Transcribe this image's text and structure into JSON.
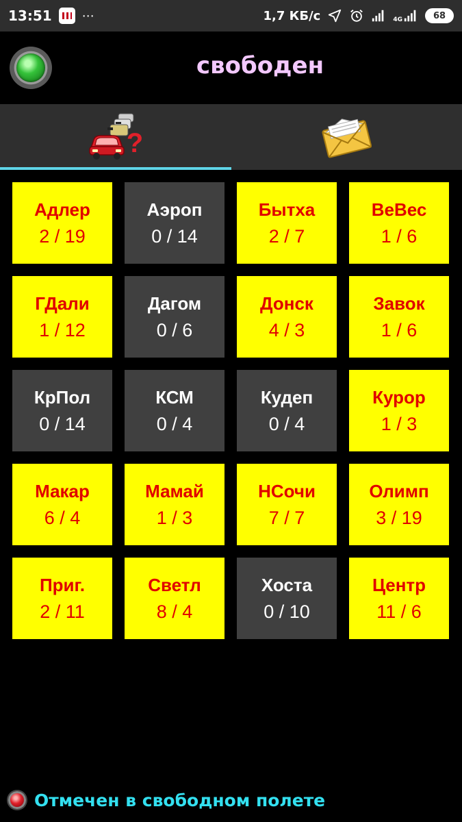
{
  "statusbar": {
    "time": "13:51",
    "dots": "⋯",
    "speed": "1,7 КБ/с",
    "network": "4G",
    "battery": "68"
  },
  "header": {
    "title": "свободен",
    "led_color": "#35c23a"
  },
  "tabs": [
    {
      "icon": "taxi-queue-icon",
      "active": true
    },
    {
      "icon": "envelope-icon",
      "active": false
    }
  ],
  "zones": [
    {
      "name": "Адлер",
      "count": "2 / 19",
      "state": "hot"
    },
    {
      "name": "Аэроп",
      "count": "0 / 14",
      "state": "cold"
    },
    {
      "name": "Бытха",
      "count": "2 / 7",
      "state": "hot"
    },
    {
      "name": "ВеВес",
      "count": "1 / 6",
      "state": "hot"
    },
    {
      "name": "ГДали",
      "count": "1 / 12",
      "state": "hot"
    },
    {
      "name": "Дагом",
      "count": "0 / 6",
      "state": "cold"
    },
    {
      "name": "Донск",
      "count": "4 / 3",
      "state": "hot"
    },
    {
      "name": "Завок",
      "count": "1 / 6",
      "state": "hot"
    },
    {
      "name": "КрПол",
      "count": "0 / 14",
      "state": "cold"
    },
    {
      "name": "КСМ",
      "count": "0 / 4",
      "state": "cold"
    },
    {
      "name": "Кудеп",
      "count": "0 / 4",
      "state": "cold"
    },
    {
      "name": "Курор",
      "count": "1 / 3",
      "state": "hot"
    },
    {
      "name": "Макар",
      "count": "6 / 4",
      "state": "hot"
    },
    {
      "name": "Мамай",
      "count": "1 / 3",
      "state": "hot"
    },
    {
      "name": "НСочи",
      "count": "7 / 7",
      "state": "hot"
    },
    {
      "name": "Олимп",
      "count": "3 / 19",
      "state": "hot"
    },
    {
      "name": "Приг.",
      "count": "2 / 11",
      "state": "hot"
    },
    {
      "name": "Светл",
      "count": "8 / 4",
      "state": "hot"
    },
    {
      "name": "Хоста",
      "count": "0 / 10",
      "state": "cold"
    },
    {
      "name": "Центр",
      "count": "11 / 6",
      "state": "hot"
    }
  ],
  "colors": {
    "hot_bg": "#ffff00",
    "hot_text": "#e00000",
    "cold_bg": "#404040",
    "cold_text": "#ffffff",
    "title": "#f3c8ff",
    "footer_text": "#33e0f0",
    "tab_indicator": "#5fd4e8"
  },
  "footer": {
    "text": "Отмечен в свободном полете",
    "led_color": "#e0202a"
  }
}
